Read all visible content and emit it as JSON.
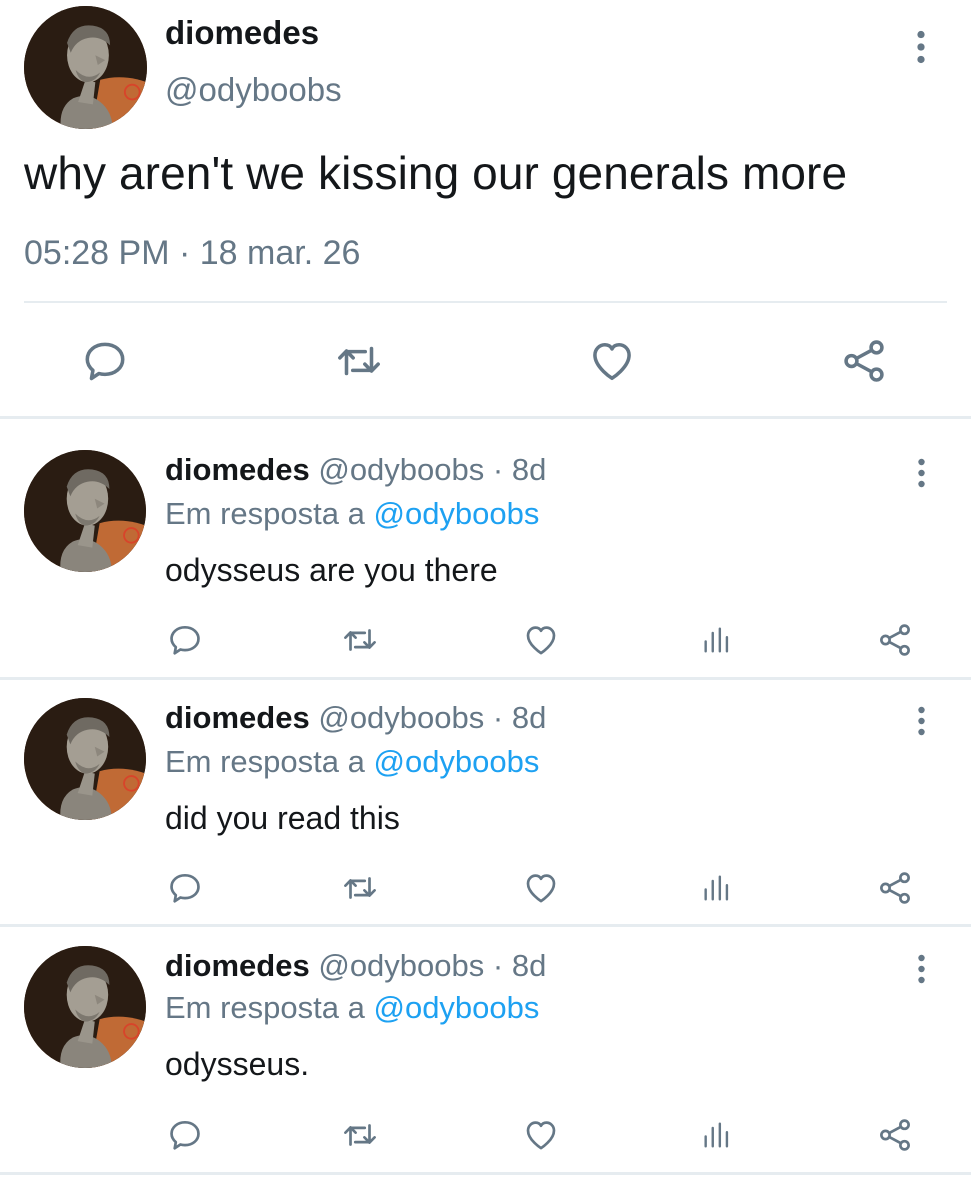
{
  "main_tweet": {
    "name": "diomedes",
    "handle": "@odyboobs",
    "text": "why aren't we kissing our generals more",
    "time": "05:28 PM",
    "separator": "·",
    "date": "18 mar. 26",
    "actions": [
      "reply-icon",
      "retweet-icon",
      "like-icon",
      "share-icon"
    ]
  },
  "replies": [
    {
      "name": "diomedes",
      "handle": "@odyboobs",
      "separator": "·",
      "time": "8d",
      "reply_prefix": "Em resposta a ",
      "reply_mention": "@odyboobs",
      "text": "odysseus are you there"
    },
    {
      "name": "diomedes",
      "handle": "@odyboobs",
      "separator": "·",
      "time": "8d",
      "reply_prefix": "Em resposta a ",
      "reply_mention": "@odyboobs",
      "text": "did you read this"
    },
    {
      "name": "diomedes",
      "handle": "@odyboobs",
      "separator": "·",
      "time": "8d",
      "reply_prefix": "Em resposta a ",
      "reply_mention": "@odyboobs",
      "text": "odysseus."
    }
  ],
  "reply_actions": [
    "reply-icon",
    "retweet-icon",
    "like-icon",
    "analytics-icon",
    "share-icon"
  ],
  "colors": {
    "text": "#14171a",
    "secondary": "#657786",
    "link": "#1da1f2",
    "divider": "#e6ecf0"
  }
}
